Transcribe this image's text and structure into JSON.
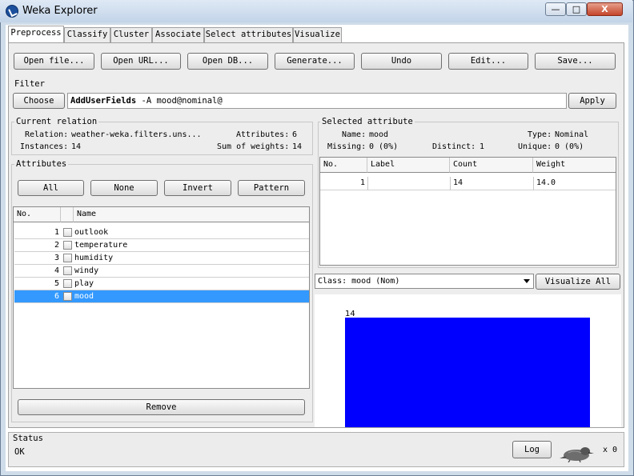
{
  "window": {
    "title": "Weka Explorer",
    "minimize_label": "—",
    "maximize_label": "□",
    "close_label": "X"
  },
  "tabs": [
    {
      "label": "Preprocess",
      "active": true
    },
    {
      "label": "Classify"
    },
    {
      "label": "Cluster"
    },
    {
      "label": "Associate"
    },
    {
      "label": "Select attributes"
    },
    {
      "label": "Visualize"
    }
  ],
  "toolbar": {
    "open_file": "Open file...",
    "open_url": "Open URL...",
    "open_db": "Open DB...",
    "generate": "Generate...",
    "undo": "Undo",
    "edit": "Edit...",
    "save": "Save..."
  },
  "filter": {
    "section_label": "Filter",
    "choose_label": "Choose",
    "name": "AddUserFields",
    "args": " -A mood@nominal@",
    "apply_label": "Apply"
  },
  "current_relation": {
    "section_label": "Current relation",
    "relation_label": "Relation:",
    "relation_value": "weather-weka.filters.uns...",
    "instances_label": "Instances:",
    "instances_value": "14",
    "attributes_label": "Attributes:",
    "attributes_value": "6",
    "sum_weights_label": "Sum of weights:",
    "sum_weights_value": "14"
  },
  "attributes": {
    "section_label": "Attributes",
    "all_label": "All",
    "none_label": "None",
    "invert_label": "Invert",
    "pattern_label": "Pattern",
    "col_no": "No.",
    "col_name": "Name",
    "rows": [
      {
        "no": "1",
        "name": "outlook"
      },
      {
        "no": "2",
        "name": "temperature"
      },
      {
        "no": "3",
        "name": "humidity"
      },
      {
        "no": "4",
        "name": "windy"
      },
      {
        "no": "5",
        "name": "play"
      },
      {
        "no": "6",
        "name": "mood",
        "selected": true
      }
    ],
    "remove_label": "Remove"
  },
  "selected_attribute": {
    "section_label": "Selected attribute",
    "name_label": "Name:",
    "name_value": "mood",
    "type_label": "Type:",
    "type_value": "Nominal",
    "missing_label": "Missing:",
    "missing_value": "0 (0%)",
    "distinct_label": "Distinct:",
    "distinct_value": "1",
    "unique_label": "Unique:",
    "unique_value": "0 (0%)",
    "table": {
      "col_no": "No.",
      "col_label": "Label",
      "col_count": "Count",
      "col_weight": "Weight",
      "rows": [
        {
          "no": "1",
          "label": "",
          "count": "14",
          "weight": "14.0"
        }
      ]
    }
  },
  "class_selector": {
    "value": "Class: mood (Nom)",
    "visualize_all_label": "Visualize All"
  },
  "chart_data": {
    "type": "bar",
    "categories": [
      ""
    ],
    "values": [
      14
    ],
    "bar_labels": [
      "14"
    ],
    "color": "#0000ff"
  },
  "status": {
    "section_label": "Status",
    "text": "OK",
    "log_label": "Log",
    "count": "x 0"
  }
}
